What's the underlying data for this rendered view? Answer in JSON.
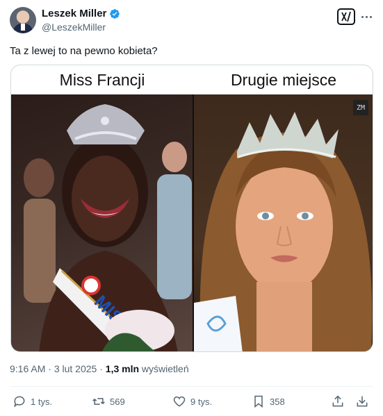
{
  "author": {
    "name": "Leszek Miller",
    "handle": "@LeszekMiller"
  },
  "tweet": {
    "text": "Ta z lewej to na pewno kobieta?"
  },
  "media": {
    "left_caption": "Miss Francji",
    "right_caption": "Drugie miejsce",
    "watermark": "ZM",
    "sash_text": "MISS FR"
  },
  "meta": {
    "time": "9:16 AM",
    "dot": "·",
    "date": "3 lut 2025",
    "views_count": "1,3 mln",
    "views_label": "wyświetleń"
  },
  "actions": {
    "replies": "1 tys.",
    "reposts": "569",
    "likes": "9 tys.",
    "bookmarks": "358"
  },
  "colors": {
    "verified": "#1d9bf0",
    "secondary_text": "#536471",
    "border": "#cfd9de"
  }
}
